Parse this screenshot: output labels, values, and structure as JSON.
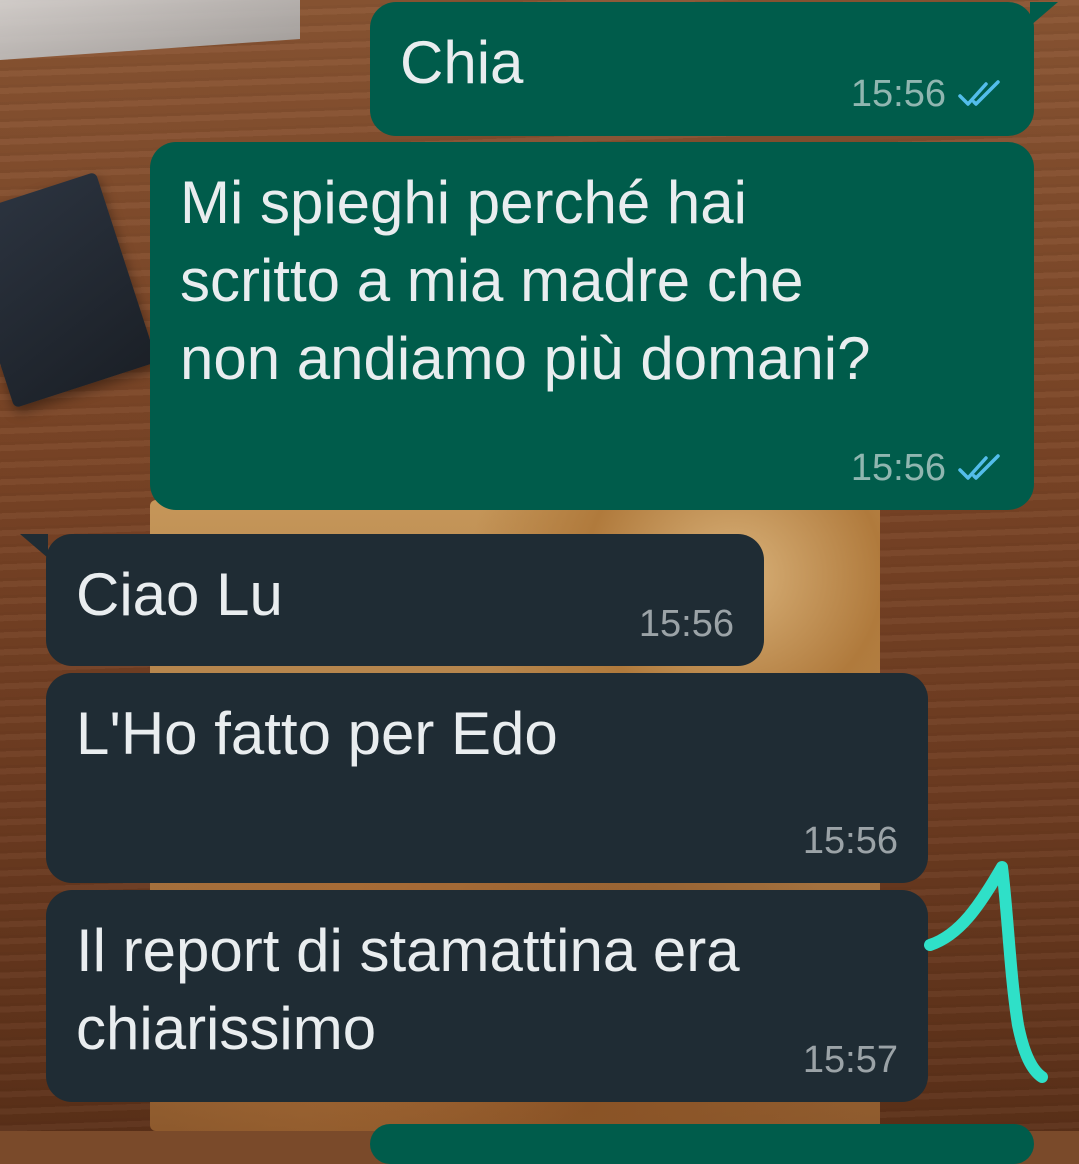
{
  "messages": [
    {
      "direction": "outgoing",
      "text": "Chia",
      "time": "15:56",
      "status": "read"
    },
    {
      "direction": "outgoing",
      "text": "Mi spieghi perché hai\nscritto a mia madre che\nnon andiamo più domani?",
      "time": "15:56",
      "status": "read"
    },
    {
      "direction": "incoming",
      "text": "Ciao Lu",
      "time": "15:56"
    },
    {
      "direction": "incoming",
      "text": "L'Ho fatto per Edo",
      "time": "15:56"
    },
    {
      "direction": "incoming",
      "text": "Il report di stamattina era\nchiarissimo",
      "time": "15:57"
    }
  ],
  "colors": {
    "outgoing_bubble": "#005c4b",
    "incoming_bubble": "#1f2c34",
    "read_ticks": "#53bdeb",
    "message_text": "#e9edef",
    "doodle": "#2fe0c8"
  },
  "icons": {
    "read_status": "double-check-icon"
  }
}
